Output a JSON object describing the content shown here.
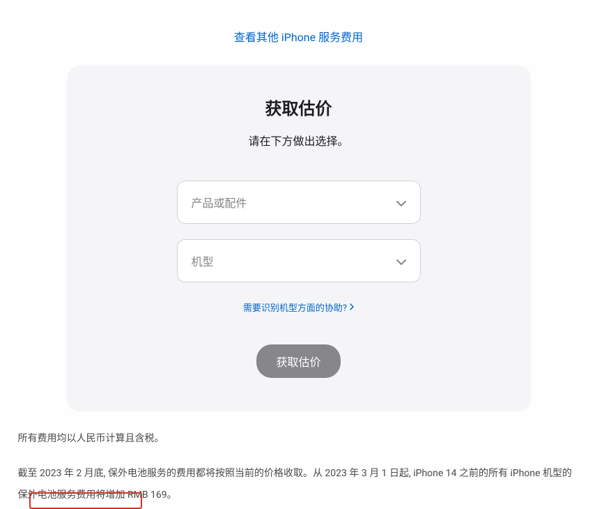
{
  "topLink": {
    "text": "查看其他 iPhone 服务费用"
  },
  "card": {
    "title": "获取估价",
    "subtitle": "请在下方做出选择。",
    "select1": {
      "placeholder": "产品或配件"
    },
    "select2": {
      "placeholder": "机型"
    },
    "helpLink": {
      "text": "需要识别机型方面的协助?"
    },
    "submitButton": {
      "label": "获取估价"
    }
  },
  "footer": {
    "line1": "所有费用均以人民币计算且含税。",
    "line2": "截至 2023 年 2 月底, 保外电池服务的费用都将按照当前的价格收取。从 2023 年 3 月 1 日起, iPhone 14 之前的所有 iPhone 机型的保外电池服务费用将增加 RMB 169。"
  }
}
